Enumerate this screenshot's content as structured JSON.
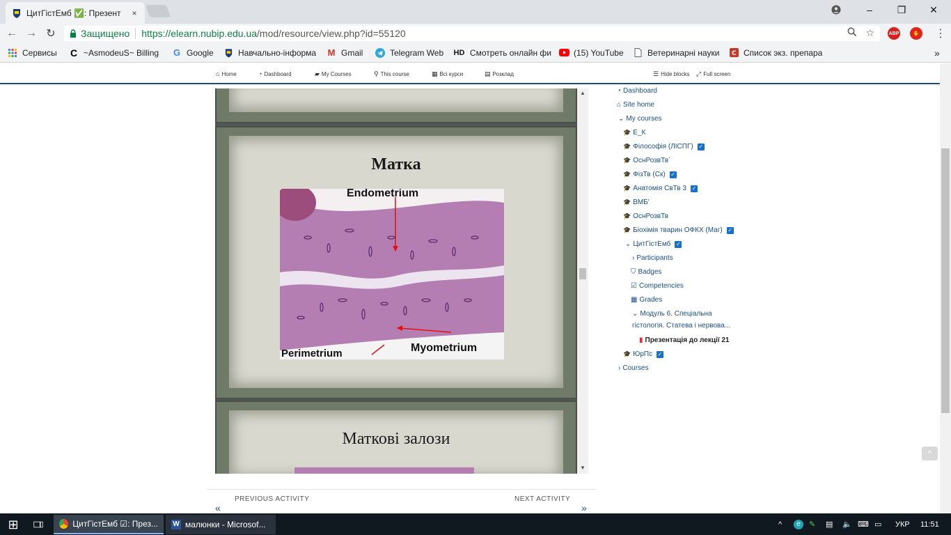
{
  "browser": {
    "tab_title": "ЦитГістЕмб ✅: Презент",
    "tab_close": "×",
    "secure_label": "Защищено",
    "url_host": "https://elearn.nubip.edu.ua",
    "url_path": "/mod/resource/view.php?id=55120",
    "window_controls": [
      "–",
      "❐",
      "✕"
    ],
    "ext_abp": "ABP"
  },
  "bookmarks": [
    {
      "icon": "apps-icon",
      "label": "Сервисы"
    },
    {
      "icon": "c-icon",
      "label": "~AsmodeuS~ Billing"
    },
    {
      "icon": "google-icon",
      "label": "Google"
    },
    {
      "icon": "nubip-icon",
      "label": "Навчально-інформа"
    },
    {
      "icon": "gmail-icon",
      "label": "Gmail"
    },
    {
      "icon": "telegram-icon",
      "label": "Telegram Web"
    },
    {
      "icon": "hd-icon",
      "label": "Смотреть онлайн фи"
    },
    {
      "icon": "youtube-icon",
      "label": "(15) YouTube"
    },
    {
      "icon": "page-icon",
      "label": "Ветеринарні науки"
    },
    {
      "icon": "doc-icon",
      "label": "Список экз. препара"
    }
  ],
  "bookmarks_more": "»",
  "bm_hd": "HD",
  "sitenav": {
    "home": "Home",
    "dashboard": "Dashboard",
    "my_courses": "My Courses",
    "this_course": "This course",
    "all_courses": "Всі курси",
    "schedule": "Розклад",
    "hide_blocks": "Hide blocks",
    "full_screen": "Full screen"
  },
  "slides": {
    "slide1_title": "Матка",
    "label_endometrium": "Endometrium",
    "label_perimetrium": "Perimetrium",
    "label_myometrium": "Myometrium",
    "slide2_title": "Маткові залози"
  },
  "tree": {
    "dashboard": "Dashboard",
    "site_home": "Site home",
    "my_courses": "My courses",
    "courses_list": [
      {
        "label": "Е_К",
        "checked": false
      },
      {
        "label": "Філософія (ЛІСПГ)",
        "checked": true
      },
      {
        "label": "ОснРозвТв`",
        "checked": false
      },
      {
        "label": "ФізТв (Ск)",
        "checked": true
      },
      {
        "label": "Анатомія СвТв 3",
        "checked": true
      },
      {
        "label": "ВМБ'",
        "checked": false
      },
      {
        "label": "ОснРозвТв",
        "checked": false
      },
      {
        "label": "Біохімія тварин ОФКХ (Маг)",
        "checked": true
      },
      {
        "label": "ЦитГістЕмб",
        "checked": true
      }
    ],
    "participants": "Participants",
    "badges": "Badges",
    "competencies": "Competencies",
    "grades": "Grades",
    "module_line1": "Модуль 6. Спеціальна",
    "module_line2": "гістологія. Статева і нервова...",
    "presentation": "Презентація до лекції 21",
    "yurps": "ЮрПс",
    "courses": "Courses",
    "check": "✓"
  },
  "activity_nav": {
    "prev_label": "PREVIOUS ACTIVITY",
    "next_label": "NEXT ACTIVITY",
    "prev_arrow": "«",
    "next_arrow": "»"
  },
  "taskbar": {
    "start": "⊞",
    "chrome_item": "ЦитГістЕмб ☑: През...",
    "word_item": "малюнки - Microsof...",
    "lang": "УКР",
    "time": "11:51"
  }
}
